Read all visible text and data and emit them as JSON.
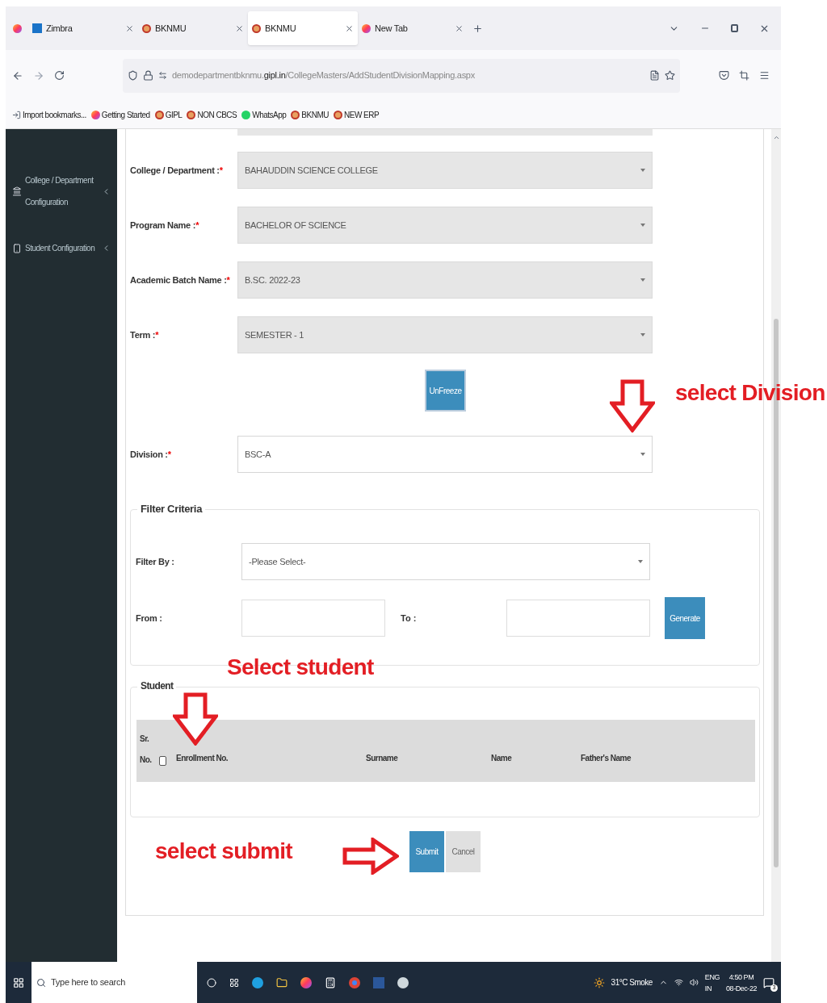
{
  "browser": {
    "tabs": [
      {
        "title": "Zimbra",
        "kind": "zimbra",
        "selected": false
      },
      {
        "title": "BKNMU",
        "kind": "emblem",
        "selected": false
      },
      {
        "title": "BKNMU",
        "kind": "emblem",
        "selected": true
      },
      {
        "title": "New Tab",
        "kind": "firefox",
        "selected": false
      }
    ],
    "url_host": "demodepartmentbknmu.",
    "url_domain": "gipl.in",
    "url_path": "/CollegeMasters/AddStudentDivisionMapping.aspx",
    "bookmarks": [
      {
        "label": "Import bookmarks...",
        "kind": "import"
      },
      {
        "label": "Getting Started",
        "kind": "firefox"
      },
      {
        "label": "GIPL",
        "kind": "emblem"
      },
      {
        "label": "NON CBCS",
        "kind": "emblem"
      },
      {
        "label": "WhatsApp",
        "kind": "whatsapp"
      },
      {
        "label": "BKNMU",
        "kind": "emblem"
      },
      {
        "label": "NEW ERP",
        "kind": "emblem"
      }
    ]
  },
  "sidebar": {
    "items": [
      {
        "label": "College / Department Configuration",
        "kind": "building"
      },
      {
        "label": "Student Configuration",
        "kind": "phone"
      }
    ]
  },
  "form": {
    "fields": [
      {
        "label": "College / Department :",
        "value": "BAHAUDDIN SCIENCE COLLEGE",
        "disabled": true
      },
      {
        "label": "Program Name :",
        "value": "BACHELOR OF SCIENCE",
        "disabled": true
      },
      {
        "label": "Academic Batch Name :",
        "value": "B.SC. 2022-23",
        "disabled": true
      },
      {
        "label": "Term :",
        "value": "SEMESTER - 1",
        "disabled": true
      }
    ],
    "required_mark": "*",
    "unfreeze_button": "UnFreeze",
    "division": {
      "label": "Division :",
      "value": "BSC-A",
      "disabled": false
    },
    "filter_criteria": {
      "title": "Filter Criteria",
      "filter_by_label": "Filter By :",
      "filter_by_value": "-Please Select-",
      "from_label": "From :",
      "to_label": "To :",
      "generate_button": "Generate"
    },
    "student_details": {
      "title": "Student",
      "columns": [
        "Sr. No.",
        "Enrollment No.",
        "Surname",
        "Name",
        "Father's Name"
      ],
      "select_all_checked": false
    },
    "buttons": [
      {
        "label": "Submit",
        "kind": "primary"
      },
      {
        "label": "Cancel",
        "kind": "secondary"
      }
    ]
  },
  "annotations": [
    {
      "text": "select Division",
      "kind": "down"
    },
    {
      "text": "Select student",
      "kind": "down"
    },
    {
      "text": "select submit",
      "kind": "right"
    }
  ],
  "taskbar": {
    "search_placeholder": "Type here to search",
    "weather": "31°C Smoke",
    "language": "ENG",
    "region": "IN",
    "time": "4:50 PM",
    "date": "08-Dec-22",
    "notifications": "3"
  }
}
